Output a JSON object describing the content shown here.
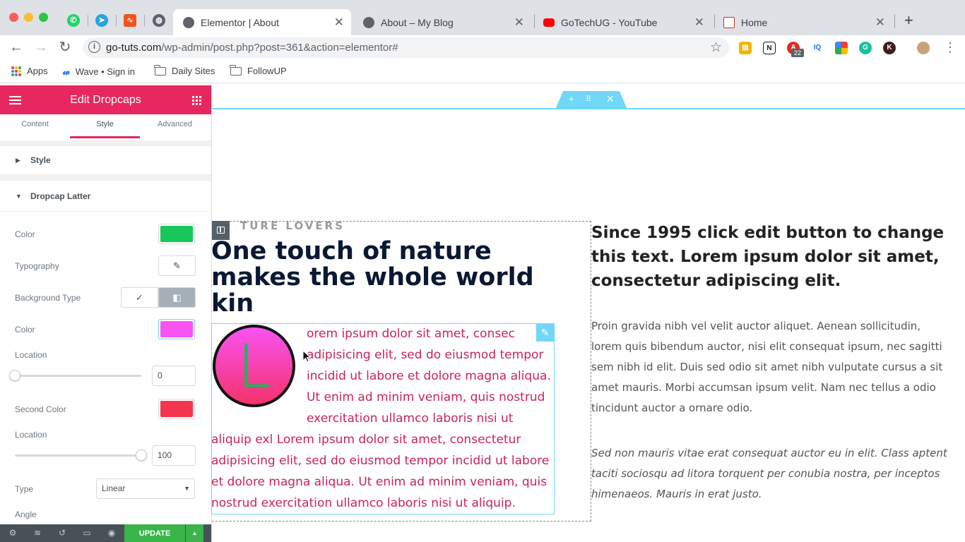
{
  "browser": {
    "tabs": [
      {
        "title": "Elementor | About",
        "active": true
      },
      {
        "title": "About – My Blog",
        "active": false
      },
      {
        "title": "GoTechUG - YouTube",
        "active": false
      },
      {
        "title": "Home",
        "active": false
      }
    ],
    "new_tab": "+",
    "url_host": "go-tuts.com",
    "url_path": "/wp-admin/post.php?post=361&action=elementor#",
    "extension_badge": "22",
    "bookmarks": [
      "Apps",
      "Wave • Sign in",
      "Daily Sites",
      "FollowUP"
    ]
  },
  "panel": {
    "title": "Edit Dropcaps",
    "tabs": [
      "Content",
      "Style",
      "Advanced"
    ],
    "active_tab": "Style",
    "sections": {
      "style": "Style",
      "dropcap": "Dropcap Latter"
    },
    "controls": {
      "color_label": "Color",
      "color_value": "#17c75a",
      "typography_label": "Typography",
      "background_type_label": "Background Type",
      "bg_color_label": "Color",
      "bg_color_value": "#f953f2",
      "location_label": "Location",
      "location_value": "0",
      "second_color_label": "Second Color",
      "second_color_value": "#f3364d",
      "location2_label": "Location",
      "location2_value": "100",
      "type_label": "Type",
      "type_value": "Linear",
      "angle_label": "Angle"
    },
    "update_label": "UPDATE"
  },
  "canvas": {
    "eyebrow": "TURE LOVERS",
    "heading_lines": [
      "One touch of nature",
      "makes the whole world",
      "kin"
    ],
    "dropcap_letter": "L",
    "dropcap_lines": [
      "orem ipsum dolor sit amet, consec",
      "adipisicing elit, sed do eiusmod tempor",
      "incidid ut labore et dolore magna aliqua.",
      "Ut enim ad minim veniam, quis nostrud",
      "exercitation ullamco laboris nisi ut",
      "aliquip exl Lorem ipsum dolor sit amet, consectetur",
      "adipisicing elit, sed do eiusmod tempor incidid ut labore",
      "et dolore magna aliqua. Ut enim ad minim veniam, quis",
      "nostrud exercitation ullamco laboris nisi ut aliquip."
    ],
    "right_heading_lines": [
      "Since 1995 click edit button to change",
      "this text. Lorem ipsum dolor sit amet,",
      "consectetur adipiscing elit."
    ],
    "paragraph1_lines": [
      "Proin gravida nibh vel velit auctor aliquet. Aenean sollicitudin,",
      "lorem quis bibendum auctor, nisi elit consequat ipsum, nec sagitti",
      "sem nibh id elit. Duis sed odio sit amet nibh vulputate cursus a sit",
      "amet mauris. Morbi accumsan ipsum velit. Nam nec tellus a odio",
      "tincidunt auctor a ornare odio."
    ],
    "paragraph2_lines": [
      "Sed non mauris vitae erat consequat auctor eu in elit. Class aptent",
      "taciti sociosqu ad litora torquent per conubia nostra, per inceptos",
      "himenaeos. Mauris in erat justo."
    ]
  },
  "colors": {
    "elementor_accent": "#e6285f",
    "editor_outline": "#71d7f7",
    "update_green": "#39b54a",
    "dropcap_text": "#c7245b"
  }
}
